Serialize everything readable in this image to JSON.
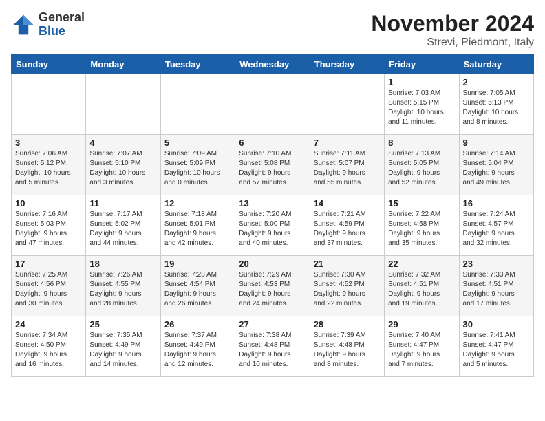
{
  "header": {
    "logo_general": "General",
    "logo_blue": "Blue",
    "title": "November 2024",
    "location": "Strevi, Piedmont, Italy"
  },
  "weekdays": [
    "Sunday",
    "Monday",
    "Tuesday",
    "Wednesday",
    "Thursday",
    "Friday",
    "Saturday"
  ],
  "rows": [
    [
      {
        "day": "",
        "info": ""
      },
      {
        "day": "",
        "info": ""
      },
      {
        "day": "",
        "info": ""
      },
      {
        "day": "",
        "info": ""
      },
      {
        "day": "",
        "info": ""
      },
      {
        "day": "1",
        "info": "Sunrise: 7:03 AM\nSunset: 5:15 PM\nDaylight: 10 hours\nand 11 minutes."
      },
      {
        "day": "2",
        "info": "Sunrise: 7:05 AM\nSunset: 5:13 PM\nDaylight: 10 hours\nand 8 minutes."
      }
    ],
    [
      {
        "day": "3",
        "info": "Sunrise: 7:06 AM\nSunset: 5:12 PM\nDaylight: 10 hours\nand 5 minutes."
      },
      {
        "day": "4",
        "info": "Sunrise: 7:07 AM\nSunset: 5:10 PM\nDaylight: 10 hours\nand 3 minutes."
      },
      {
        "day": "5",
        "info": "Sunrise: 7:09 AM\nSunset: 5:09 PM\nDaylight: 10 hours\nand 0 minutes."
      },
      {
        "day": "6",
        "info": "Sunrise: 7:10 AM\nSunset: 5:08 PM\nDaylight: 9 hours\nand 57 minutes."
      },
      {
        "day": "7",
        "info": "Sunrise: 7:11 AM\nSunset: 5:07 PM\nDaylight: 9 hours\nand 55 minutes."
      },
      {
        "day": "8",
        "info": "Sunrise: 7:13 AM\nSunset: 5:05 PM\nDaylight: 9 hours\nand 52 minutes."
      },
      {
        "day": "9",
        "info": "Sunrise: 7:14 AM\nSunset: 5:04 PM\nDaylight: 9 hours\nand 49 minutes."
      }
    ],
    [
      {
        "day": "10",
        "info": "Sunrise: 7:16 AM\nSunset: 5:03 PM\nDaylight: 9 hours\nand 47 minutes."
      },
      {
        "day": "11",
        "info": "Sunrise: 7:17 AM\nSunset: 5:02 PM\nDaylight: 9 hours\nand 44 minutes."
      },
      {
        "day": "12",
        "info": "Sunrise: 7:18 AM\nSunset: 5:01 PM\nDaylight: 9 hours\nand 42 minutes."
      },
      {
        "day": "13",
        "info": "Sunrise: 7:20 AM\nSunset: 5:00 PM\nDaylight: 9 hours\nand 40 minutes."
      },
      {
        "day": "14",
        "info": "Sunrise: 7:21 AM\nSunset: 4:59 PM\nDaylight: 9 hours\nand 37 minutes."
      },
      {
        "day": "15",
        "info": "Sunrise: 7:22 AM\nSunset: 4:58 PM\nDaylight: 9 hours\nand 35 minutes."
      },
      {
        "day": "16",
        "info": "Sunrise: 7:24 AM\nSunset: 4:57 PM\nDaylight: 9 hours\nand 32 minutes."
      }
    ],
    [
      {
        "day": "17",
        "info": "Sunrise: 7:25 AM\nSunset: 4:56 PM\nDaylight: 9 hours\nand 30 minutes."
      },
      {
        "day": "18",
        "info": "Sunrise: 7:26 AM\nSunset: 4:55 PM\nDaylight: 9 hours\nand 28 minutes."
      },
      {
        "day": "19",
        "info": "Sunrise: 7:28 AM\nSunset: 4:54 PM\nDaylight: 9 hours\nand 26 minutes."
      },
      {
        "day": "20",
        "info": "Sunrise: 7:29 AM\nSunset: 4:53 PM\nDaylight: 9 hours\nand 24 minutes."
      },
      {
        "day": "21",
        "info": "Sunrise: 7:30 AM\nSunset: 4:52 PM\nDaylight: 9 hours\nand 22 minutes."
      },
      {
        "day": "22",
        "info": "Sunrise: 7:32 AM\nSunset: 4:51 PM\nDaylight: 9 hours\nand 19 minutes."
      },
      {
        "day": "23",
        "info": "Sunrise: 7:33 AM\nSunset: 4:51 PM\nDaylight: 9 hours\nand 17 minutes."
      }
    ],
    [
      {
        "day": "24",
        "info": "Sunrise: 7:34 AM\nSunset: 4:50 PM\nDaylight: 9 hours\nand 16 minutes."
      },
      {
        "day": "25",
        "info": "Sunrise: 7:35 AM\nSunset: 4:49 PM\nDaylight: 9 hours\nand 14 minutes."
      },
      {
        "day": "26",
        "info": "Sunrise: 7:37 AM\nSunset: 4:49 PM\nDaylight: 9 hours\nand 12 minutes."
      },
      {
        "day": "27",
        "info": "Sunrise: 7:38 AM\nSunset: 4:48 PM\nDaylight: 9 hours\nand 10 minutes."
      },
      {
        "day": "28",
        "info": "Sunrise: 7:39 AM\nSunset: 4:48 PM\nDaylight: 9 hours\nand 8 minutes."
      },
      {
        "day": "29",
        "info": "Sunrise: 7:40 AM\nSunset: 4:47 PM\nDaylight: 9 hours\nand 7 minutes."
      },
      {
        "day": "30",
        "info": "Sunrise: 7:41 AM\nSunset: 4:47 PM\nDaylight: 9 hours\nand 5 minutes."
      }
    ]
  ]
}
